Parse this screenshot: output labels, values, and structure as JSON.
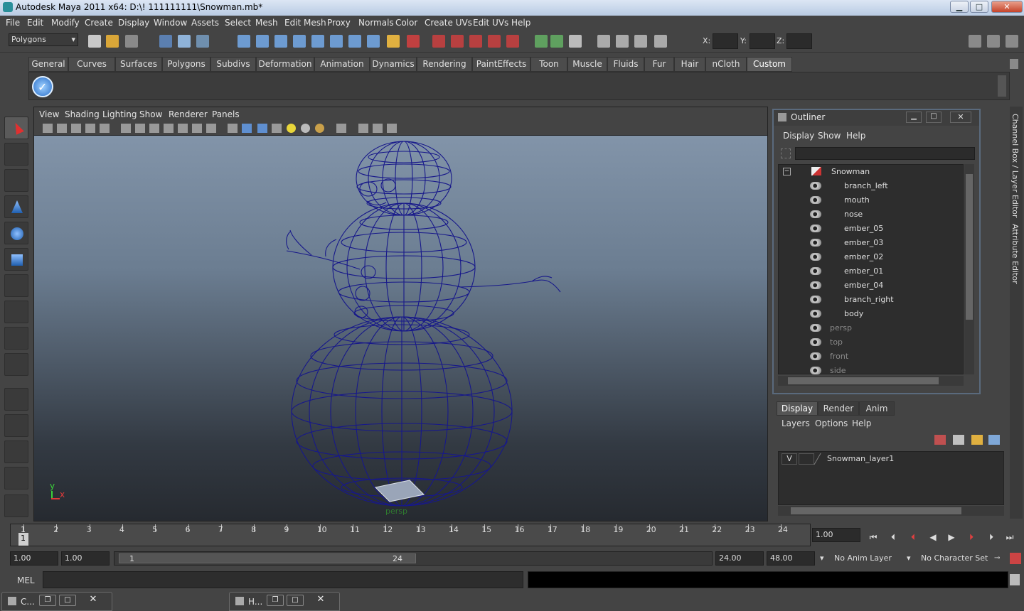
{
  "window": {
    "title": "Autodesk Maya 2011 x64: D:\\! 111111111\\Snowman.mb*",
    "min": "▁",
    "max": "□",
    "close": "✕"
  },
  "menubar": [
    "File",
    "Edit",
    "Modify",
    "Create",
    "Display",
    "Window",
    "Assets",
    "Select",
    "Mesh",
    "Edit Mesh",
    "Proxy",
    "Normals",
    "Color",
    "Create UVs",
    "Edit UVs",
    "Help"
  ],
  "toolbar": {
    "mode": "Polygons",
    "x_label": "X:",
    "y_label": "Y:",
    "z_label": "Z:"
  },
  "shelf": {
    "tabs": [
      "General",
      "Curves",
      "Surfaces",
      "Polygons",
      "Subdivs",
      "Deformation",
      "Animation",
      "Dynamics",
      "Rendering",
      "PaintEffects",
      "Toon",
      "Muscle",
      "Fluids",
      "Fur",
      "Hair",
      "nCloth",
      "Custom"
    ],
    "active": "Custom"
  },
  "viewport": {
    "menu": [
      "View",
      "Shading",
      "Lighting",
      "Show",
      "Renderer",
      "Panels"
    ],
    "camera_label": "persp",
    "axis_y": "y",
    "axis_x": "x"
  },
  "outliner": {
    "title": "Outliner",
    "menu": [
      "Display",
      "Show",
      "Help"
    ],
    "root": "Snowman",
    "children": [
      "branch_left",
      "mouth",
      "nose",
      "ember_05",
      "ember_03",
      "ember_02",
      "ember_01",
      "ember_04",
      "branch_right",
      "body"
    ],
    "cameras": [
      "persp",
      "top",
      "front",
      "side"
    ]
  },
  "layer_editor": {
    "tabs": [
      "Display",
      "Render",
      "Anim"
    ],
    "menu": [
      "Layers",
      "Options",
      "Help"
    ],
    "layer": {
      "visible": "V",
      "name": "Snowman_layer1"
    }
  },
  "side_tabs": [
    "Channel Box / Layer Editor",
    "Attribute Editor"
  ],
  "timeline": {
    "frames": [
      1,
      2,
      3,
      4,
      5,
      6,
      7,
      8,
      9,
      10,
      11,
      12,
      13,
      14,
      15,
      16,
      17,
      18,
      19,
      20,
      21,
      22,
      23,
      24
    ],
    "current_frame": "1",
    "current_time": "1.00"
  },
  "range": {
    "start": "1.00",
    "playback_start": "1.00",
    "slider_start": "1",
    "slider_end": "24",
    "playback_end": "24.00",
    "end": "48.00",
    "anim_layer": "No Anim Layer",
    "character_set": "No Character Set"
  },
  "command": {
    "label": "MEL"
  },
  "taskbar": [
    {
      "label": "C..."
    },
    {
      "label": "H..."
    }
  ]
}
